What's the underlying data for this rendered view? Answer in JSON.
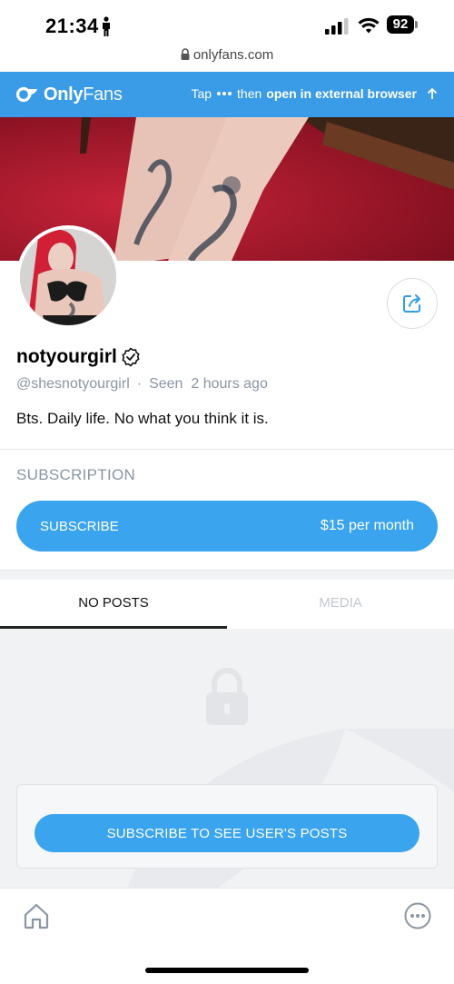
{
  "status_bar": {
    "time": "21:34",
    "battery": "92"
  },
  "browser": {
    "url": "onlyfans.com"
  },
  "app_banner": {
    "brand_bold": "Only",
    "brand_light": "Fans",
    "tip_prefix": "Tap",
    "tip_middle": "then",
    "tip_action": "open in external browser"
  },
  "profile": {
    "display_name": "notyourgirl",
    "username": "@shesnotyourgirl",
    "seen_label": "Seen",
    "seen_time": "2 hours ago",
    "bio": "Bts. Daily life. No what you think it is."
  },
  "subscription": {
    "section_label": "SUBSCRIPTION",
    "button_label": "SUBSCRIBE",
    "price": "$15 per month"
  },
  "tabs": [
    {
      "label": "NO POSTS",
      "active": true
    },
    {
      "label": "MEDIA",
      "active": false
    }
  ],
  "locked": {
    "button_label": "SUBSCRIBE TO SEE USER'S POSTS"
  },
  "colors": {
    "brand_blue": "#3aa4ee",
    "banner_blue": "#3a9be6",
    "muted_text": "#8a96a3"
  },
  "icons": [
    "person-icon",
    "signal-icon",
    "wifi-icon",
    "lock-icon",
    "of-logo-icon",
    "dots-icon",
    "arrow-up-icon",
    "share-icon",
    "verified-icon",
    "padlock-icon",
    "home-icon",
    "more-icon"
  ]
}
